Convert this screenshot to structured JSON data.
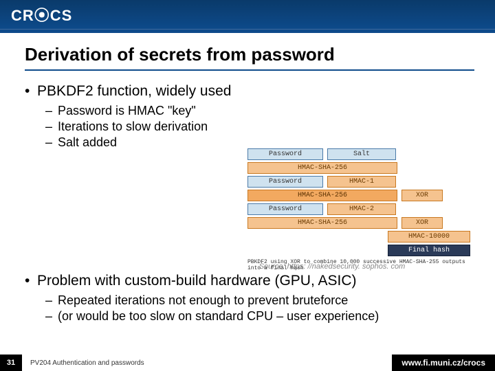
{
  "logo": "CR⦿CS",
  "title": "Derivation of secrets from password",
  "bullets": {
    "b1": "PBKDF2 function, widely used",
    "b1_sub": [
      "Password is HMAC \"key\"",
      "Iterations to slow derivation",
      "Salt added"
    ],
    "b2": "Problem with custom-build hardware (GPU, ASIC)",
    "b2_sub": [
      "Repeated iterations not enough to prevent bruteforce",
      "(or would be too slow on standard CPU – user experience)"
    ]
  },
  "source": "Source: https: //nakedsecurity. sophos. com",
  "diagram": {
    "r1a": "Password",
    "r1b": "Salt",
    "r2": "HMAC-SHA-256",
    "r3a": "Password",
    "r3b": "HMAC-1",
    "r4": "HMAC-SHA-256",
    "r4b": "XOR",
    "r5a": "Password",
    "r5b": "HMAC-2",
    "r6": "HMAC-SHA-256",
    "r6b": "XOR",
    "r7": "HMAC-10000",
    "r8": "Final hash",
    "caption": "PBKDF2 using XOR to combine 10,000 successive HMAC-SHA-255 outputs into a final hash"
  },
  "footer": {
    "page": "31",
    "course": "PV204 Authentication and passwords",
    "url": "www.fi.muni.cz/crocs"
  }
}
